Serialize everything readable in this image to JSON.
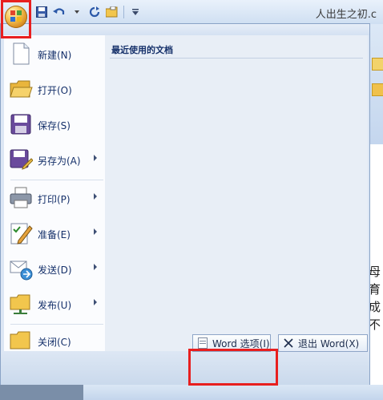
{
  "window": {
    "doc_title": "人出生之初.c"
  },
  "office_menu": {
    "items": [
      {
        "label": "新建(N)",
        "icon": "new-document-icon",
        "submenu": false
      },
      {
        "label": "打开(O)",
        "icon": "open-folder-icon",
        "submenu": false
      },
      {
        "label": "保存(S)",
        "icon": "save-icon",
        "submenu": false
      },
      {
        "label": "另存为(A)",
        "icon": "save-as-icon",
        "submenu": true
      },
      {
        "label": "打印(P)",
        "icon": "printer-icon",
        "submenu": true
      },
      {
        "label": "准备(E)",
        "icon": "prepare-icon",
        "submenu": true
      },
      {
        "label": "发送(D)",
        "icon": "send-icon",
        "submenu": true
      },
      {
        "label": "发布(U)",
        "icon": "publish-icon",
        "submenu": true
      },
      {
        "label": "关闭(C)",
        "icon": "close-folder-icon",
        "submenu": false
      }
    ],
    "recent_header": "最近使用的文档",
    "word_options_label": "Word 选项(I)",
    "exit_word_label": "退出 Word(X)"
  },
  "document": {
    "visible_chars": [
      "母",
      "育",
      "成",
      "不"
    ]
  },
  "colors": {
    "highlight_box": "#e81f1f",
    "menu_text": "#15306a"
  }
}
